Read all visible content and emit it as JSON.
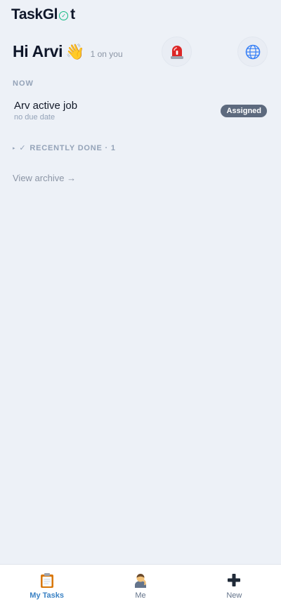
{
  "brand": {
    "part1": "TaskGl",
    "check_glyph": "✓",
    "part2": "t"
  },
  "greeting": {
    "title": "Hi Arvi",
    "emoji": "👋",
    "subtitle": "1 on you"
  },
  "header_actions": [
    {
      "name": "siren-icon",
      "color": "#dc2626"
    },
    {
      "name": "globe-icon",
      "color": "#3b82f6"
    }
  ],
  "sections": {
    "now_label": "NOW"
  },
  "tasks": [
    {
      "title": "Arv active job",
      "due": "no due date",
      "status": "Assigned"
    }
  ],
  "recently_done": {
    "caret": "▸",
    "check": "✓",
    "label": "RECENTLY DONE · 1"
  },
  "archive_link": "View archive →",
  "nav": [
    {
      "label": "My Tasks",
      "icon": "clipboard-icon",
      "active": true
    },
    {
      "label": "Me",
      "icon": "person-icon",
      "active": false
    },
    {
      "label": "New",
      "icon": "plus-icon",
      "active": false
    }
  ],
  "colors": {
    "accent": "#3b82c4",
    "badge": "#5d6a7e",
    "brand_check": "#10b981",
    "background": "#edf1f7"
  }
}
